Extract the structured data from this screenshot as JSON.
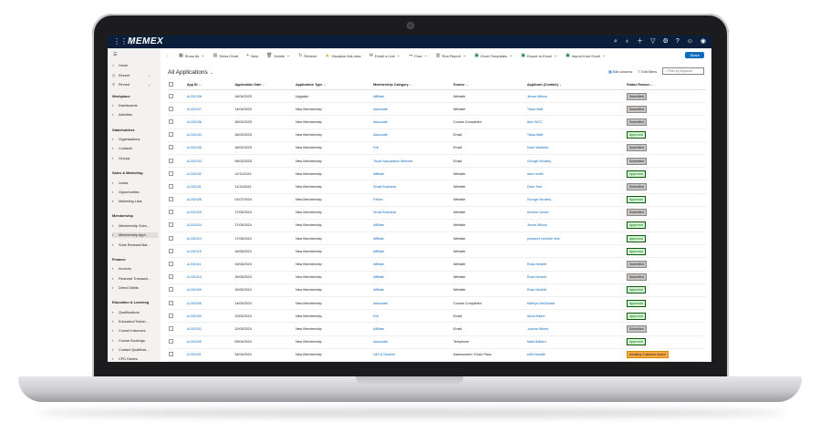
{
  "app": {
    "logo": "MEMEX"
  },
  "top_icons": [
    "search-icon",
    "lightbulb-icon",
    "plus-icon",
    "filter-icon",
    "settings-icon",
    "help-icon",
    "people-icon",
    "user-icon"
  ],
  "command_bar": {
    "back": "←",
    "show_as": "Show As",
    "show_chart": "Show Chart",
    "new": "New",
    "delete": "Delete",
    "refresh": "Refresh",
    "visualize": "Visualize this view",
    "email_link": "Email a Link",
    "flow": "Flow",
    "run_report": "Run Report",
    "excel_templates": "Excel Templates",
    "export_excel": "Export to Excel",
    "import_excel": "Import from Excel",
    "share": "Share"
  },
  "sidebar": {
    "pinned_items": [
      {
        "icon": "home-icon",
        "label": "Home"
      },
      {
        "icon": "clock-icon",
        "label": "Recent"
      },
      {
        "icon": "pin-icon",
        "label": "Pinned"
      }
    ],
    "sections": [
      {
        "title": "Workplace",
        "items": [
          {
            "icon": "dashboard-icon",
            "label": "Dashboards"
          },
          {
            "icon": "activities-icon",
            "label": "Activities"
          }
        ]
      },
      {
        "title": "Stakeholders",
        "items": [
          {
            "icon": "organisation-icon",
            "label": "Organisations"
          },
          {
            "icon": "contact-icon",
            "label": "Contacts"
          },
          {
            "icon": "groups-icon",
            "label": "Groups"
          }
        ]
      },
      {
        "title": "Sales & Marketing",
        "items": [
          {
            "icon": "phone-icon",
            "label": "Leads"
          },
          {
            "icon": "opportunity-icon",
            "label": "Opportunities"
          },
          {
            "icon": "list-icon",
            "label": "Marketing Lists"
          }
        ]
      },
      {
        "title": "Membership",
        "items": [
          {
            "icon": "membership-icon",
            "label": "Membership Subs..."
          },
          {
            "icon": "application-icon",
            "label": "Membership Appl..."
          },
          {
            "icon": "renewal-icon",
            "label": "Subs Renewal Bat..."
          }
        ]
      },
      {
        "title": "Finance",
        "items": [
          {
            "icon": "invoice-icon",
            "label": "Invoices"
          },
          {
            "icon": "transaction-icon",
            "label": "Financial Transacti..."
          },
          {
            "icon": "debit-icon",
            "label": "Direct Debits"
          }
        ]
      },
      {
        "title": "Education & Learning",
        "items": [
          {
            "icon": "qualification-icon",
            "label": "Qualifications"
          },
          {
            "icon": "education-icon",
            "label": "Education/Trainin..."
          },
          {
            "icon": "course-icon",
            "label": "Course Instances"
          },
          {
            "icon": "booking-icon",
            "label": "Course Bookings"
          },
          {
            "icon": "contact-qual-icon",
            "label": "Contact Qualificat..."
          },
          {
            "icon": "cpd-icon",
            "label": "CPD Diaries"
          }
        ]
      }
    ]
  },
  "view": {
    "title": "All Applications",
    "edit_columns": "Edit columns",
    "edit_filters": "Edit filters",
    "filter_placeholder": "Filter by keyword"
  },
  "table": {
    "columns": [
      "App ID",
      "Application Date",
      "Application Type",
      "Membership Category",
      "Source",
      "Applicant (Contact)",
      "Status Reason"
    ],
    "rows": [
      [
        "A-001038",
        "16/04/2025",
        "Upgrade",
        "Affiliate",
        "Website",
        "Jenna Wilson",
        "Submitted"
      ],
      [
        "A-001037",
        "14/04/2025",
        "New Membership",
        "Associate",
        "Website",
        "Tiana Watt",
        "Submitted"
      ],
      [
        "A-001036",
        "26/02/2025",
        "New Membership",
        "Associate",
        "Course Completed",
        "Alex WCC",
        "Submitted"
      ],
      [
        "A-001034",
        "26/02/2025",
        "New Membership",
        "Associate",
        "Email",
        "Tiana Watt",
        "Approved"
      ],
      [
        "A-001035",
        "18/02/2025",
        "New Membership",
        "Full",
        "Email",
        "Dave Warfield",
        "Submitted"
      ],
      [
        "A-001033",
        "06/02/2025",
        "New Membership",
        "Trade Association Member",
        "Email",
        "George Woolley",
        "Submitted"
      ],
      [
        "A-001032",
        "12/11/2024",
        "New Membership",
        "Affiliate",
        "Website",
        "dave smith",
        "Approved"
      ],
      [
        "A-001031",
        "11/11/2024",
        "New Membership",
        "Small Business",
        "Website",
        "Dave Test",
        "Submitted"
      ],
      [
        "A-001026",
        "01/07/2024",
        "New Membership",
        "Fellow",
        "Website",
        "George Woolley",
        "Approved"
      ],
      [
        "A-001025",
        "17/05/2024",
        "New Membership",
        "Small Business",
        "Website",
        "Andrew Vance",
        "Submitted"
      ],
      [
        "A-001024",
        "17/05/2024",
        "New Membership",
        "Affiliate",
        "Website",
        "Jenna Wilson",
        "Approved"
      ],
      [
        "A-001023",
        "17/05/2024",
        "New Membership",
        "Affiliate",
        "Website",
        "prospect member test",
        "Approved"
      ],
      [
        "A-001019",
        "16/05/2024",
        "New Membership",
        "Affiliate",
        "Website",
        "",
        "Approved"
      ],
      [
        "A-001011",
        "15/05/2024",
        "New Membership",
        "Affiliate",
        "Website",
        "Ross Nesbitt",
        "Submitted"
      ],
      [
        "A-001010",
        "15/05/2024",
        "New Membership",
        "Affiliate",
        "Website",
        "Ross Nesbitt",
        "Submitted"
      ],
      [
        "A-001009",
        "15/05/2024",
        "New Membership",
        "Affiliate",
        "Website",
        "Ross Nesbitt",
        "Approved"
      ],
      [
        "A-001008",
        "14/05/2024",
        "New Membership",
        "Associate",
        "Course Completed",
        "Kathryn McDonald",
        "Approved"
      ],
      [
        "A-001000",
        "10/05/2024",
        "New Membership",
        "Full",
        "Email",
        "Anna Atkins",
        "Approved"
      ],
      [
        "A-001002",
        "10/05/2024",
        "New Membership",
        "Affiliate",
        "Email",
        "Joanne Wines",
        "Submitted"
      ],
      [
        "A-001005",
        "09/04/2024",
        "New Membership",
        "Associate",
        "Telephone",
        "Mark Ballard",
        "Approved"
      ],
      [
        "A-001001",
        "04/04/2024",
        "New Membership",
        "UKCA Student",
        "Assessment / Exam Pass",
        "edhf Nesbitt",
        "Awaiting Customer Action"
      ],
      [
        "A-001006",
        "01/02/2024",
        "New Membership",
        "Small Business",
        "Email",
        "",
        "In Assessment"
      ],
      [
        "A-001007",
        "15/05/2023",
        "New Membership",
        "Associate",
        "Email",
        "Bruce Wayne",
        "Approved"
      ]
    ]
  }
}
